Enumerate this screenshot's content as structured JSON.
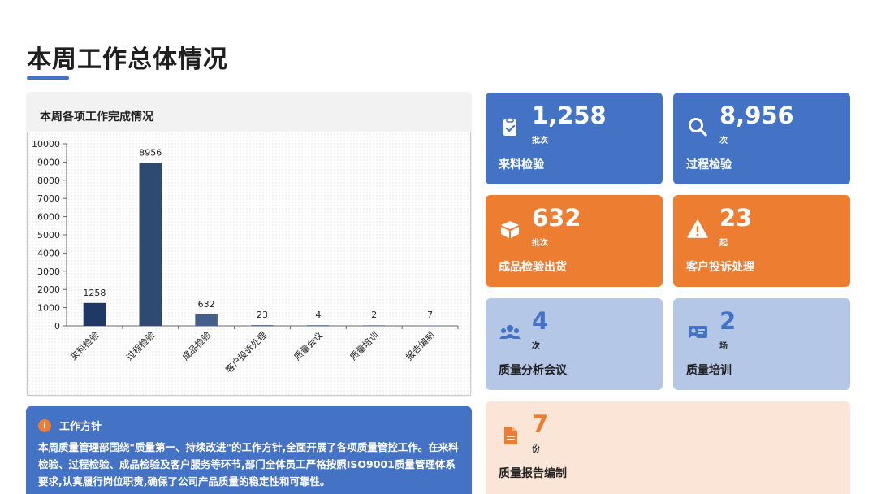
{
  "page": {
    "title": "本周工作总体情况"
  },
  "chart_panel": {
    "title": "本周各项工作完成情况"
  },
  "chart_data": {
    "type": "bar",
    "categories": [
      "来料检验",
      "过程检验",
      "成品检验",
      "客户投诉处理",
      "质量会议",
      "质量培训",
      "报告编制"
    ],
    "values": [
      1258,
      8956,
      632,
      23,
      4,
      2,
      7
    ],
    "data_labels": [
      "1258",
      "8956",
      "632",
      "23",
      "4",
      "2",
      "7"
    ],
    "ylim": [
      0,
      10000
    ],
    "yticks": [
      0,
      1000,
      2000,
      3000,
      4000,
      5000,
      6000,
      7000,
      8000,
      9000,
      10000
    ],
    "colors": [
      "#1f3864",
      "#2e4a73",
      "#44608a",
      "#5b7597",
      "#7088a8",
      "#8a9cb8",
      "#a6b4c9"
    ],
    "grid": false,
    "title": "",
    "xlabel": "",
    "ylabel": ""
  },
  "policy": {
    "icon": "info-icon",
    "icon_glyph": "i",
    "title": "工作方针",
    "text": "本周质量管理部围绕\"质量第一、持续改进\"的工作方针,全面开展了各项质量管控工作。在来料检验、过程检验、成品检验及客户服务等环节,部门全体员工严格按照ISO9001质量管理体系要求,认真履行岗位职责,确保了公司产品质量的稳定性和可靠性。"
  },
  "cards": [
    {
      "icon": "clipboard-check-icon",
      "value": "1,258",
      "unit": "批次",
      "label": "来料检验",
      "style": "blue"
    },
    {
      "icon": "search-icon",
      "value": "8,956",
      "unit": "次",
      "label": "过程检验",
      "style": "blue"
    },
    {
      "icon": "box-icon",
      "value": "632",
      "unit": "批次",
      "label": "成品检验出货",
      "style": "orange"
    },
    {
      "icon": "warning-icon",
      "value": "23",
      "unit": "起",
      "label": "客户投诉处理",
      "style": "orange"
    },
    {
      "icon": "meeting-group-icon",
      "value": "4",
      "unit": "次",
      "label": "质量分析会议",
      "style": "light"
    },
    {
      "icon": "training-presentation-icon",
      "value": "2",
      "unit": "场",
      "label": "质量培训",
      "style": "light"
    },
    {
      "icon": "document-icon",
      "value": "7",
      "unit": "份",
      "label": "质量报告编制",
      "style": "peach"
    }
  ],
  "colors": {
    "blue": "#4472c4",
    "orange": "#ed7d31",
    "light_blue": "#b4c7e7",
    "peach": "#fbe5d6"
  }
}
